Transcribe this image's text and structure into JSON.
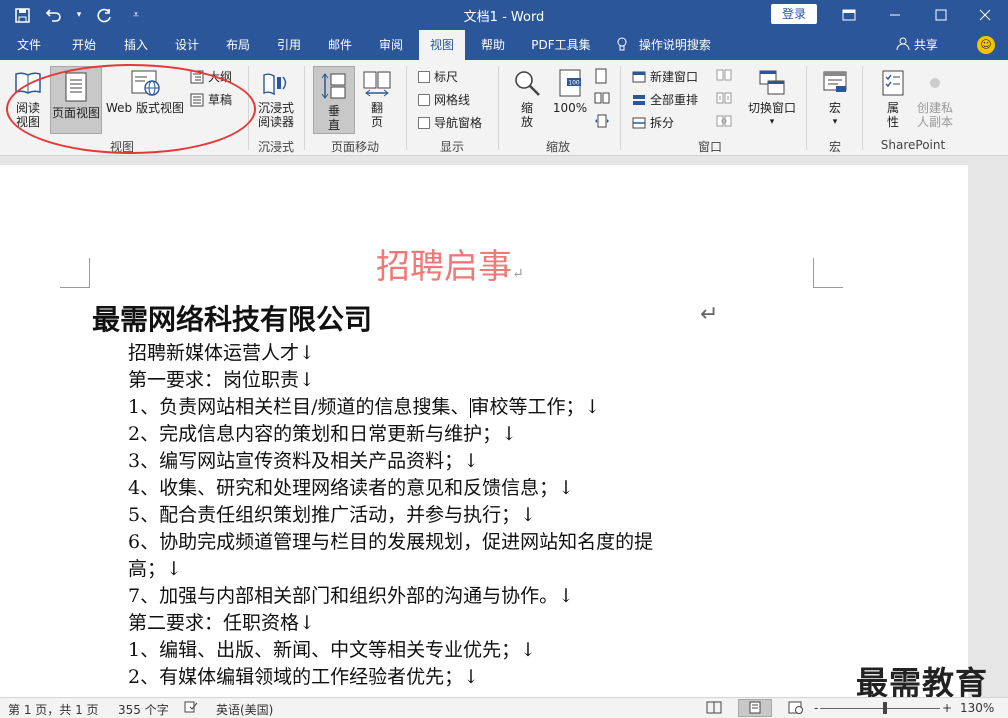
{
  "titlebar": {
    "doc_title": "文档1 - Word",
    "login": "登录",
    "qat": [
      "save-icon",
      "undo-icon",
      "redo-icon",
      "customize-icon"
    ]
  },
  "tabs": [
    {
      "label": "文件"
    },
    {
      "label": "开始"
    },
    {
      "label": "插入"
    },
    {
      "label": "设计"
    },
    {
      "label": "布局"
    },
    {
      "label": "引用"
    },
    {
      "label": "邮件"
    },
    {
      "label": "审阅"
    },
    {
      "label": "视图",
      "active": true
    },
    {
      "label": "帮助"
    },
    {
      "label": "PDF工具集"
    }
  ],
  "tell_me": "操作说明搜索",
  "share": "共享",
  "ribbon": {
    "views": {
      "read_line1": "阅读",
      "read_line2": "视图",
      "print_layout": "页面视图",
      "web_layout": "Web 版式视图",
      "outline": "大纲",
      "draft": "草稿",
      "group": "视图"
    },
    "immersive": {
      "line1": "沉浸式",
      "line2": "阅读器",
      "group": "沉浸式"
    },
    "page_move": {
      "vertical_l1": "垂",
      "vertical_l2": "直",
      "side_l1": "翻",
      "side_l2": "页",
      "group": "页面移动"
    },
    "show": {
      "ruler": "标尺",
      "gridlines": "网格线",
      "nav_pane": "导航窗格",
      "group": "显示"
    },
    "zoom": {
      "zoom_l1": "缩",
      "zoom_l2": "放",
      "pct": "100%",
      "group": "缩放"
    },
    "window": {
      "new": "新建窗口",
      "arrange": "全部重排",
      "split": "拆分",
      "switch": "切换窗口",
      "group": "窗口"
    },
    "macros": {
      "label": "宏",
      "group": "宏"
    },
    "sharepoint": {
      "props_l1": "属",
      "props_l2": "性",
      "private_l1": "创建私",
      "private_l2": "人副本",
      "group": "SharePoint"
    }
  },
  "document": {
    "heading": "招聘启事",
    "para_mark": "↵",
    "company": "最需网络科技有限公司",
    "lines": [
      "招聘新媒体运营人才↓",
      "第一要求：岗位职责↓",
      "1、负责网站相关栏目/频道的信息搜集、",
      "审校等工作；↓",
      "2、完成信息内容的策划和日常更新与维护；↓",
      "3、编写网站宣传资料及相关产品资料；↓",
      "4、收集、研究和处理网络读者的意见和反馈信息；↓",
      "5、配合责任组织策划推广活动，并参与执行；↓",
      "6、协助完成频道管理与栏目的发展规划，促进网站知名度的提",
      "高；↓",
      "7、加强与内部相关部门和组织外部的沟通与协作。↓",
      "第二要求：任职资格↓",
      "1、编辑、出版、新闻、中文等相关专业优先；↓",
      "2、有媒体编辑领域的工作经验者优先；↓"
    ]
  },
  "watermark": "最需教育",
  "status": {
    "page": "第 1 页，共 1 页",
    "words": "355 个字",
    "lang": "英语(美国)",
    "zoom": "130%",
    "zoom_minus": "-",
    "zoom_plus": "+",
    "zoom_level_pct": 54
  }
}
